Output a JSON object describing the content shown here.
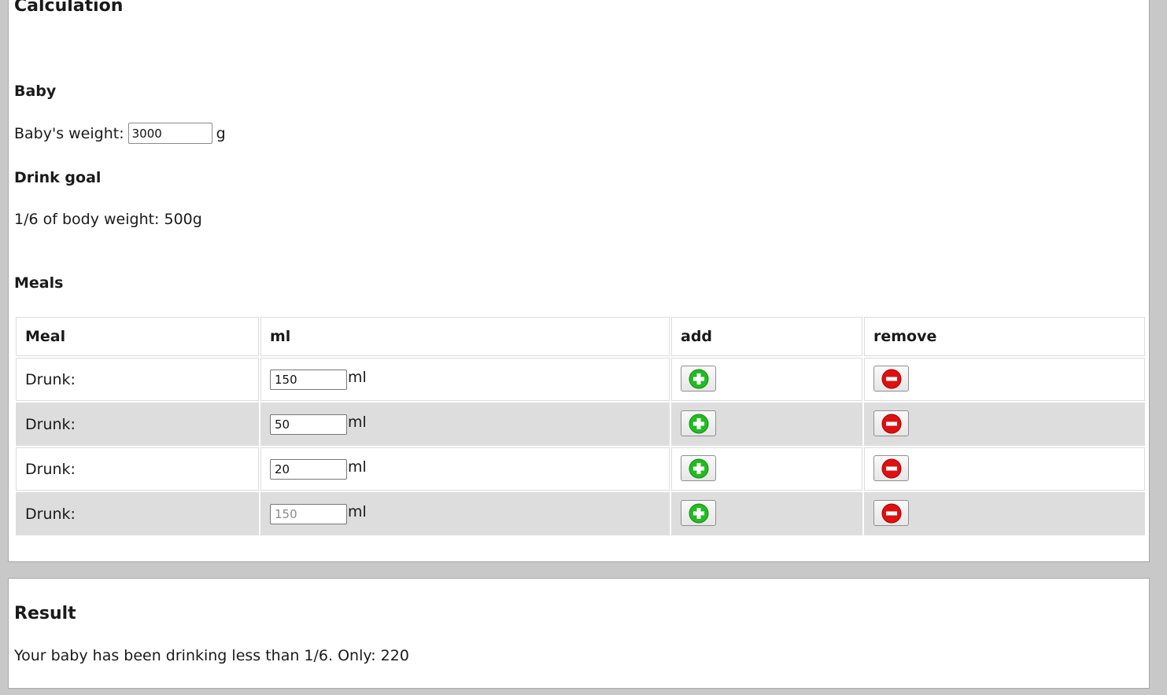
{
  "calculation": {
    "title": "Calculation",
    "baby_heading": "Baby",
    "weight_label": "Baby's weight:",
    "weight_value": "3000",
    "weight_unit": "g",
    "drink_goal_heading": "Drink goal",
    "drink_goal_text": "1/6 of body weight: 500g",
    "meals_heading": "Meals"
  },
  "table": {
    "headers": {
      "meal": "Meal",
      "ml": "ml",
      "add": "add",
      "remove": "remove"
    },
    "rows": [
      {
        "label": "Drunk:",
        "value": "150",
        "placeholder": "",
        "unit": "ml"
      },
      {
        "label": "Drunk:",
        "value": "50",
        "placeholder": "",
        "unit": "ml"
      },
      {
        "label": "Drunk:",
        "value": "20",
        "placeholder": "",
        "unit": "ml"
      },
      {
        "label": "Drunk:",
        "value": "",
        "placeholder": "150",
        "unit": "ml"
      }
    ]
  },
  "icons": {
    "add": "plus-circle-icon",
    "remove": "minus-circle-icon"
  },
  "colors": {
    "add_icon": "#22bb22",
    "remove_icon": "#e01010",
    "alt_row": "#dddddd",
    "page_bg": "#c8c8c8"
  },
  "result": {
    "heading": "Result",
    "text": "Your baby has been drinking less than 1/6. Only: 220"
  }
}
